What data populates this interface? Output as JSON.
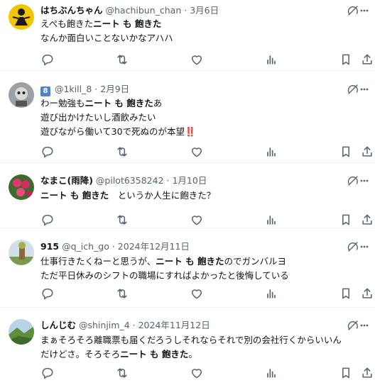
{
  "tweets": [
    {
      "name": "はちぶんちゃん",
      "handle": "@hachibun_chan",
      "date": "· 3月6日",
      "lines": [
        {
          "pre": "えぺも飽きた",
          "hl": "ニート も 飽きた",
          "post": ""
        },
        {
          "pre": "なんか面白いことないかなアハハ",
          "hl": "",
          "post": ""
        }
      ]
    },
    {
      "badge": "8",
      "name": "",
      "handle": "@1kill_8",
      "date": "· 2月9日",
      "lines": [
        {
          "pre": "わー勉強も",
          "hl": "ニート も 飽きた",
          "post": "あ"
        },
        {
          "pre": "遊び出かけたいし酒飲みたい",
          "hl": "",
          "post": ""
        },
        {
          "pre": "遊びながら働いて30で死ぬのが本望",
          "hl": "",
          "post": "",
          "emoji": "‼️"
        }
      ]
    },
    {
      "name": "なまこ(雨降)",
      "handle": "@pilot6358242",
      "date": "· 1月10日",
      "lines": [
        {
          "pre": "",
          "hl": "ニート も 飽きた",
          "post": "　というか人生に飽きた？"
        }
      ]
    },
    {
      "name": "915",
      "handle": "@q_ich_go",
      "date": "· 2024年12月11日",
      "lines": [
        {
          "pre": "仕事行きたくねーと思うが、",
          "hl": "ニート も 飽きた",
          "post": "のでガンバルヨ"
        },
        {
          "pre": "ただ平日休みのシフトの職場にすればよかったと後悔している",
          "hl": "",
          "post": ""
        }
      ]
    },
    {
      "name": "しんじむ",
      "handle": "@shinjim_4",
      "date": "· 2024年11月12日",
      "lines": [
        {
          "pre": "まぁそろそろ離職票も届くだろうしそれならそれで別の会社行くからいいん",
          "hl": "",
          "post": ""
        },
        {
          "pre": "だけどさ。そろそろ",
          "hl": "ニート も 飽きた",
          "post": "。"
        }
      ]
    }
  ],
  "icons": [
    "grok-icon",
    "more-icon",
    "reply-icon",
    "retweet-icon",
    "like-icon",
    "views-icon",
    "bookmark-icon",
    "share-icon"
  ]
}
